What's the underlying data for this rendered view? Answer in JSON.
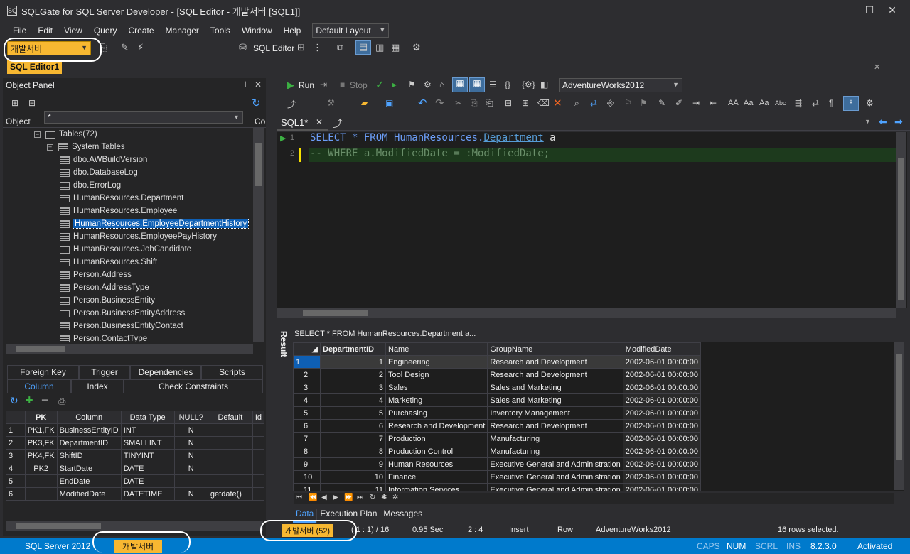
{
  "window": {
    "title": "SQLGate for SQL Server Developer - [SQL Editor - 개발서버 [SQL1]]",
    "app_icon": "SQ"
  },
  "menu": [
    "File",
    "Edit",
    "View",
    "Query",
    "Create",
    "Manager",
    "Tools",
    "Window",
    "Help"
  ],
  "layout_combo": "Default Layout",
  "connection_combo": "개발서버",
  "sql_editor_btn": "SQL Editor",
  "doc_tab": "SQL Editor1",
  "object_panel": {
    "title": "Object Panel",
    "filter": "*",
    "col_header": "Object",
    "col_header2": "Co",
    "tables_node": "Tables(72)",
    "system_tables": "System Tables",
    "items": [
      "dbo.AWBuildVersion",
      "dbo.DatabaseLog",
      "dbo.ErrorLog",
      "HumanResources.Department",
      "HumanResources.Employee",
      "HumanResources.EmployeeDepartmentHistory",
      "HumanResources.EmployeePayHistory",
      "HumanResources.JobCandidate",
      "HumanResources.Shift",
      "Person.Address",
      "Person.AddressType",
      "Person.BusinessEntity",
      "Person.BusinessEntityAddress",
      "Person.BusinessEntityContact",
      "Person.ContactType"
    ]
  },
  "detail_tabs_row1": [
    "Foreign Key",
    "Trigger",
    "Dependencies",
    "Scripts"
  ],
  "detail_tabs_row2": [
    "Column",
    "Index",
    "Check Constraints"
  ],
  "columns_grid": {
    "headers": [
      "PK",
      "Column",
      "Data Type",
      "NULL?",
      "Default",
      "Id"
    ],
    "rows": [
      [
        "1",
        "PK1,FK",
        "BusinessEntityID",
        "INT",
        "N",
        ""
      ],
      [
        "2",
        "PK3,FK",
        "DepartmentID",
        "SMALLINT",
        "N",
        ""
      ],
      [
        "3",
        "PK4,FK",
        "ShiftID",
        "TINYINT",
        "N",
        ""
      ],
      [
        "4",
        "PK2",
        "StartDate",
        "DATE",
        "N",
        ""
      ],
      [
        "5",
        "",
        "EndDate",
        "DATE",
        "",
        ""
      ],
      [
        "6",
        "",
        "ModifiedDate",
        "DATETIME",
        "N",
        "getdate()"
      ]
    ]
  },
  "editor_toolbar": {
    "run": "Run",
    "stop": "Stop",
    "database": "AdventureWorks2012"
  },
  "editor_tab": "SQL1*",
  "code": {
    "line1_a": "SELECT * FROM HumanResources.",
    "line1_b": "Department",
    "line1_c": " a",
    "line2": "-- WHERE a.ModifiedDate = :ModifiedDate;",
    "ln1": "1",
    "ln2": "2"
  },
  "result": {
    "vertical_label": "Result",
    "query_text": "SELECT * FROM HumanResources.Department a...",
    "headers": [
      "DepartmentID",
      "Name",
      "GroupName",
      "ModifiedDate"
    ],
    "rows": [
      [
        "1",
        "1",
        "Engineering",
        "Research and Development",
        "2002-06-01 00:00:00"
      ],
      [
        "2",
        "2",
        "Tool Design",
        "Research and Development",
        "2002-06-01 00:00:00"
      ],
      [
        "3",
        "3",
        "Sales",
        "Sales and Marketing",
        "2002-06-01 00:00:00"
      ],
      [
        "4",
        "4",
        "Marketing",
        "Sales and Marketing",
        "2002-06-01 00:00:00"
      ],
      [
        "5",
        "5",
        "Purchasing",
        "Inventory Management",
        "2002-06-01 00:00:00"
      ],
      [
        "6",
        "6",
        "Research and Development",
        "Research and Development",
        "2002-06-01 00:00:00"
      ],
      [
        "7",
        "7",
        "Production",
        "Manufacturing",
        "2002-06-01 00:00:00"
      ],
      [
        "8",
        "8",
        "Production Control",
        "Manufacturing",
        "2002-06-01 00:00:00"
      ],
      [
        "9",
        "9",
        "Human Resources",
        "Executive General and Administration",
        "2002-06-01 00:00:00"
      ],
      [
        "10",
        "10",
        "Finance",
        "Executive General and Administration",
        "2002-06-01 00:00:00"
      ],
      [
        "11",
        "11",
        "Information Services",
        "Executive General and Administration",
        "2002-06-01 00:00:00"
      ]
    ],
    "tabs": [
      "Data",
      "Execution Plan",
      "Messages"
    ]
  },
  "editor_status": {
    "conn_badge": "개발서버 (52)",
    "pos": "( 1 : 1) / 16",
    "time": "0.95 Sec",
    "col": "2 : 4",
    "mode": "Insert",
    "select_mode": "Row",
    "db": "AdventureWorks2012",
    "rows_selected": "16 rows selected."
  },
  "statusbar": {
    "server": "SQL Server 2012",
    "conn": "개발서버",
    "caps": "CAPS",
    "num": "NUM",
    "scrl": "SCRL",
    "ins": "INS",
    "version": "8.2.3.0",
    "activated": "Activated"
  },
  "colors": {
    "accent": "#f7b731",
    "status": "#007acc",
    "selection": "#0e5fb4"
  }
}
